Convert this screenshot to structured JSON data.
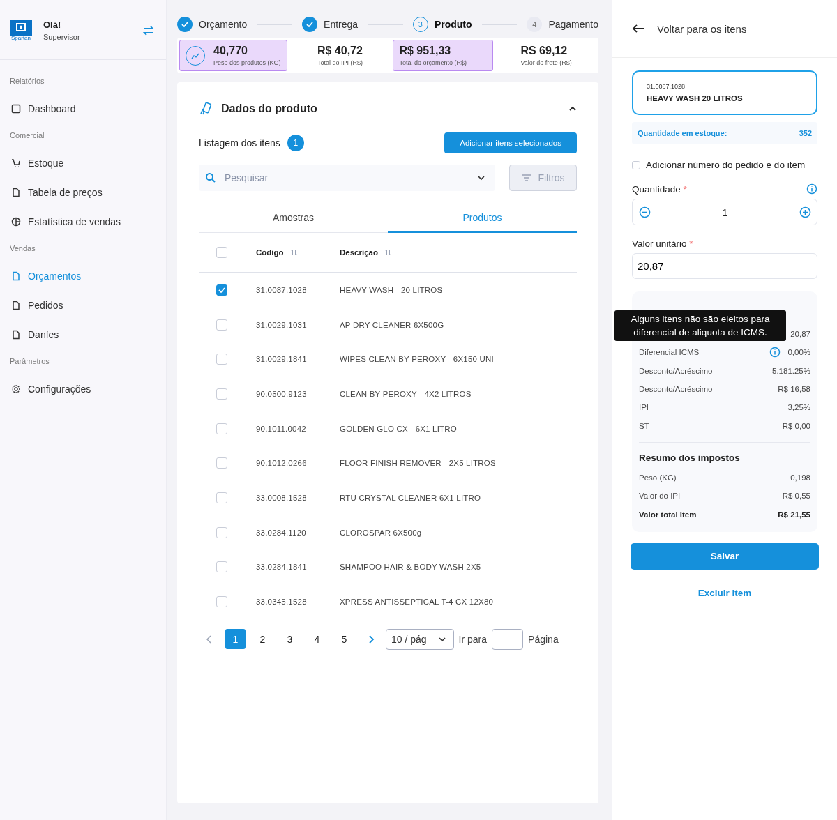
{
  "sidebar": {
    "logo_text": "Spartan",
    "greeting": "Olá!",
    "role": "Supervisor",
    "sections": [
      {
        "title": "Relatórios",
        "items": [
          {
            "label": "Dashboard",
            "selected": false
          }
        ]
      },
      {
        "title": "Comercial",
        "items": [
          {
            "label": "Estoque",
            "selected": false
          },
          {
            "label": "Tabela de preços",
            "selected": false
          },
          {
            "label": "Estatística de vendas",
            "selected": false
          }
        ]
      },
      {
        "title": "Vendas",
        "items": [
          {
            "label": "Orçamentos",
            "selected": true
          },
          {
            "label": "Pedidos",
            "selected": false
          },
          {
            "label": "Danfes",
            "selected": false
          }
        ]
      },
      {
        "title": "Parâmetros",
        "items": [
          {
            "label": "Configurações",
            "selected": false
          }
        ]
      }
    ]
  },
  "steps": [
    {
      "label": "Orçamento",
      "done": true,
      "selected": false
    },
    {
      "label": "Entrega",
      "done": true,
      "selected": false
    },
    {
      "label": "Produto",
      "number": "3",
      "done": false,
      "selected": true
    },
    {
      "label": "Pagamento",
      "number": "4",
      "done": false,
      "selected": false
    }
  ],
  "summary": [
    {
      "value": "40,770",
      "label": "Peso dos produtos (KG)",
      "highlighted": true
    },
    {
      "value": "R$ 40,72",
      "label": "Total do IPI (R$)",
      "highlighted": false
    },
    {
      "value": "R$ 951,33",
      "label": "Total do orçamento (R$)",
      "highlighted": true
    },
    {
      "value": "RS 69,12",
      "label": "Valor do frete (R$)",
      "highlighted": false
    }
  ],
  "product_section": {
    "title": "Dados do produto",
    "list_title": "Listagem dos itens",
    "count": "1",
    "add_button": "Adicionar itens selecionados",
    "search_placeholder": "Pesquisar",
    "filter_button": "Filtros",
    "tabs": [
      {
        "label": "Amostras",
        "selected": false
      },
      {
        "label": "Produtos",
        "selected": true
      }
    ],
    "table": {
      "all_checked": false,
      "columns": [
        "Código",
        "Descrição"
      ],
      "rows": [
        {
          "code": "31.0087.1028",
          "description": "HEAVY WASH - 20 LITROS",
          "checked": true
        },
        {
          "code": "31.0029.1031",
          "description": "AP DRY CLEANER 6X500G",
          "checked": false
        },
        {
          "code": "31.0029.1841",
          "description": "WIPES CLEAN BY PEROXY - 6X150 UNI",
          "checked": false
        },
        {
          "code": "90.0500.9123",
          "description": "CLEAN BY PEROXY - 4X2 LITROS",
          "checked": false
        },
        {
          "code": "90.1011.0042",
          "description": "GOLDEN GLO CX  - 6X1 LITRO",
          "checked": false
        },
        {
          "code": "90.1012.0266",
          "description": "FLOOR FINISH REMOVER - 2X5 LITROS",
          "checked": false
        },
        {
          "code": "33.0008.1528",
          "description": "RTU CRYSTAL CLEANER 6X1 LITRO",
          "checked": false
        },
        {
          "code": "33.0284.1120",
          "description": "CLOROSPAR 6X500g",
          "checked": false
        },
        {
          "code": "33.0284.1841",
          "description": "SHAMPOO HAIR & BODY WASH 2X5",
          "checked": false
        },
        {
          "code": "33.0345.1528",
          "description": "XPRESS ANTISSEPTICAL T-4 CX 12X80",
          "checked": false
        }
      ]
    },
    "pagination": {
      "pages": [
        {
          "label": "1",
          "selected": true
        },
        {
          "label": "2",
          "selected": false
        },
        {
          "label": "3",
          "selected": false
        },
        {
          "label": "4",
          "selected": false
        },
        {
          "label": "5",
          "selected": false
        }
      ],
      "page_size": "10 / pág",
      "goto_label": "Ir para",
      "page_label": "Página"
    }
  },
  "item_panel": {
    "back": "Voltar para os itens",
    "product_code": "31.0087.1028",
    "product_name": "HEAVY WASH 20 LITROS",
    "stock_label": "Quantidade em estoque:",
    "stock_value": "352",
    "order_checkbox": {
      "label": "Adicionar número do pedido e do item",
      "checked": false
    },
    "quantity": {
      "label": "Quantidade",
      "required_mark": "*",
      "value": "1"
    },
    "unit_price": {
      "label": "Valor unitário",
      "required_mark": "*",
      "value": "20,87"
    },
    "values": [
      {
        "value": "20,87"
      },
      {
        "label": "Diferencial ICMS",
        "value": "0,00%",
        "info": true
      },
      {
        "label": "Desconto/Acréscimo",
        "value": "5.181.25%"
      },
      {
        "label": "Desconto/Acréscimo",
        "value": "R$ 16,58"
      },
      {
        "label": "IPI",
        "value": "3,25%"
      },
      {
        "label": "ST",
        "value": "R$ 0,00"
      }
    ],
    "tooltip": "Alguns itens não são eleitos para diferencial de aliquota de ICMS.",
    "taxes_title": "Resumo dos impostos",
    "taxes": [
      {
        "label": "Peso (KG)",
        "value": "0,198",
        "kind": "normal"
      },
      {
        "label": "Valor do IPI",
        "value": "R$ 0,55",
        "kind": "normal"
      },
      {
        "label": "Valor total item",
        "value": "R$ 21,55",
        "kind": "total"
      }
    ],
    "save_button": "Salvar",
    "delete_link": "Excluir item"
  }
}
